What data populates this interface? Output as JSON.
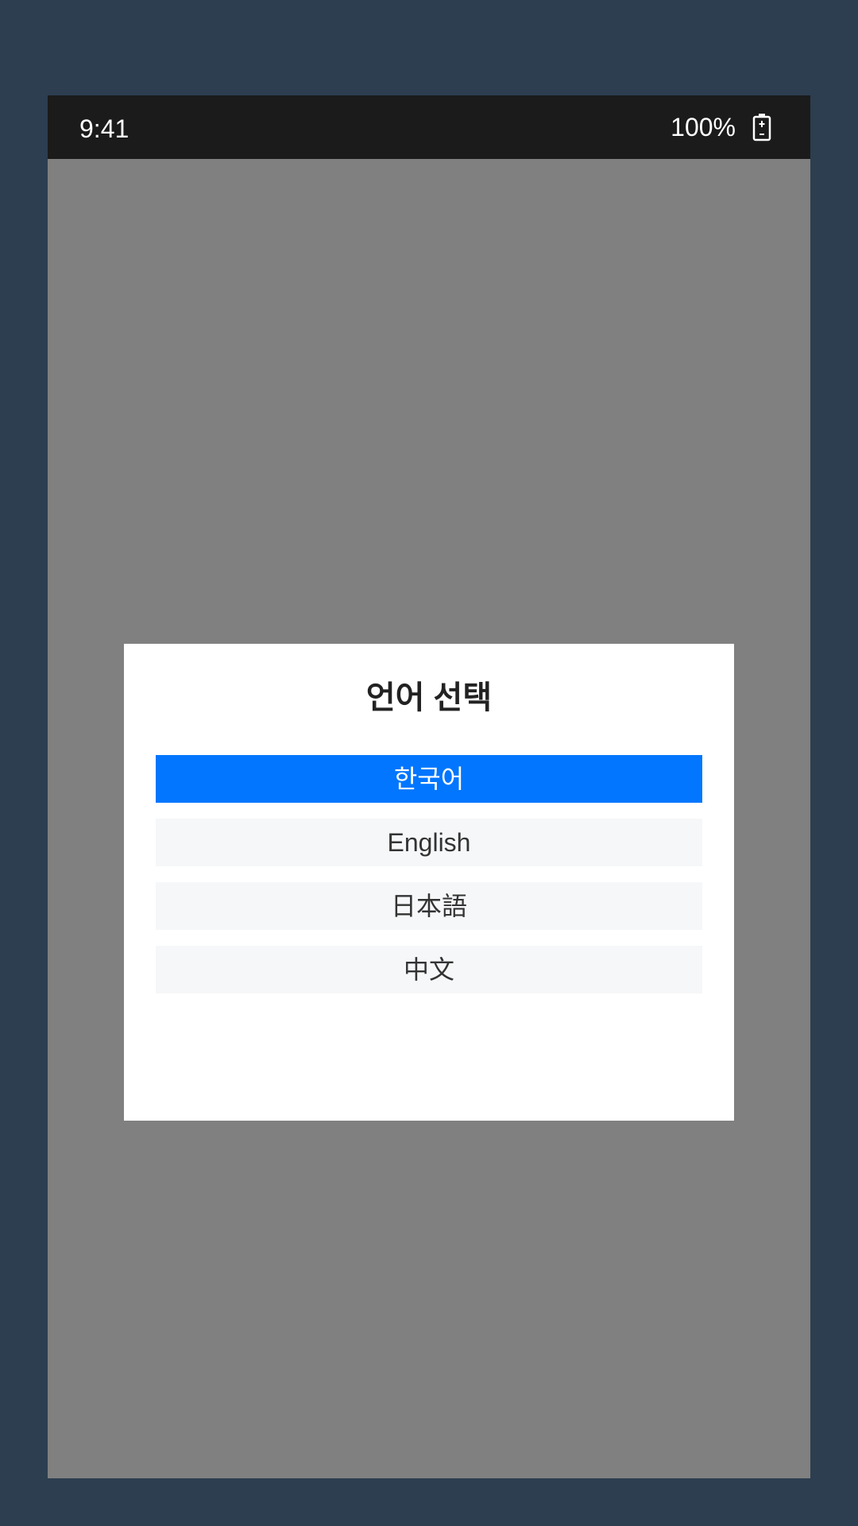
{
  "status_bar": {
    "time": "9:41",
    "battery_percent": "100%",
    "battery_icon": "battery-charging-icon"
  },
  "dialog": {
    "title": "언어 선택",
    "options": [
      {
        "label": "한국어",
        "selected": true
      },
      {
        "label": "English",
        "selected": false
      },
      {
        "label": "日本語",
        "selected": false
      },
      {
        "label": "中文",
        "selected": false
      }
    ]
  },
  "colors": {
    "selected_option": "#0276fe",
    "option_background": "#f6f7f9",
    "scrim": "#808080",
    "status_bar": "#1b1b1b",
    "backdrop": "#2c3e50"
  }
}
